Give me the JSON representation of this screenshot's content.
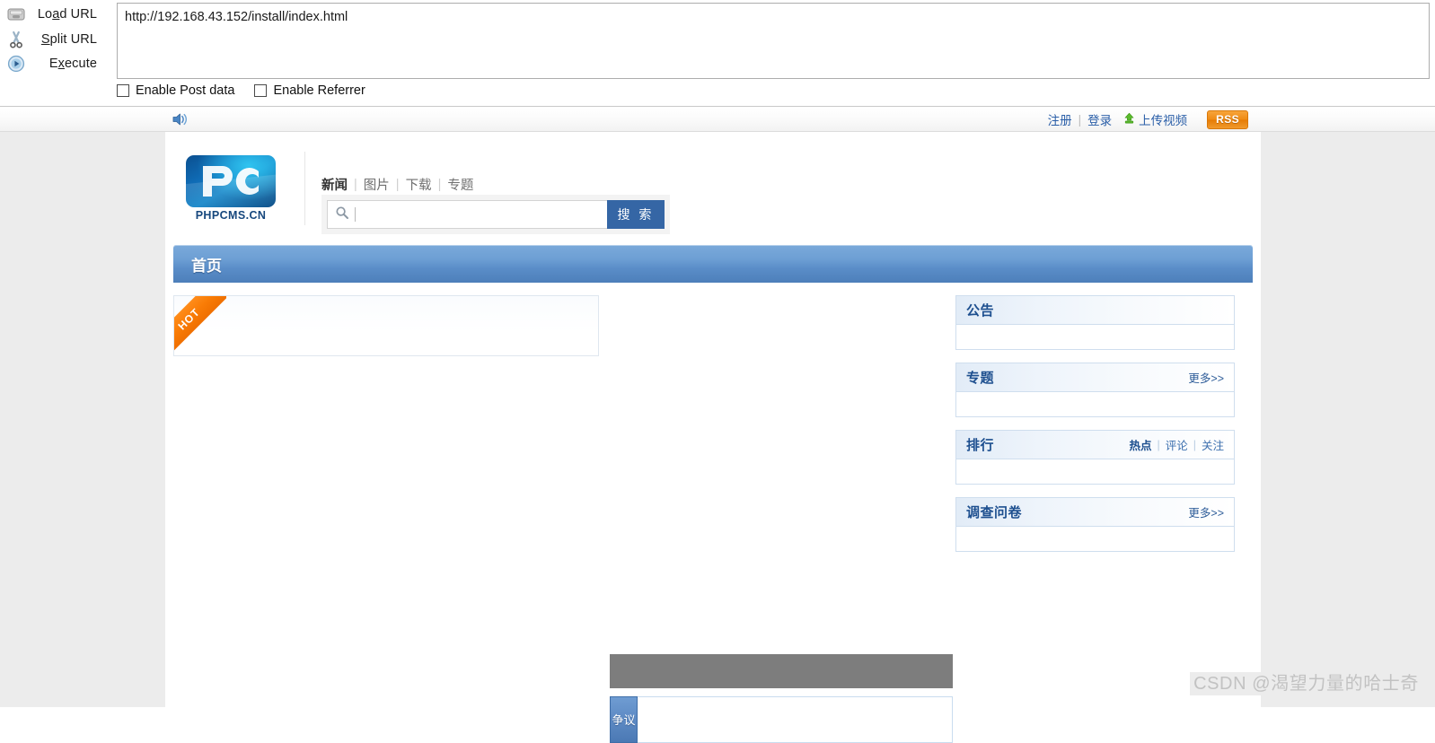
{
  "toolbar": {
    "actions": [
      {
        "icon": "load-url-icon",
        "label": "Load URL",
        "accel": "a"
      },
      {
        "icon": "scissors-icon",
        "label": "Split URL",
        "accel": "S"
      },
      {
        "icon": "execute-icon",
        "label": "Execute",
        "accel": "x"
      }
    ],
    "url_value": "http://192.168.43.152/install/index.html",
    "url_placeholder": "Enter URL",
    "checkboxes": [
      {
        "label": "Enable Post data",
        "checked": false
      },
      {
        "label": "Enable Referrer",
        "checked": false
      }
    ]
  },
  "utility_bar": {
    "speaker_icon": "speaker-icon",
    "register": "注册",
    "login": "登录",
    "upload": "上传视频",
    "upload_icon": "upload-arrow-icon",
    "rss": "RSS",
    "separator": "|"
  },
  "site_header": {
    "logo_mark": "PC",
    "logo_text": "PHPCMS.CN",
    "nav": [
      {
        "label": "新闻",
        "current": true
      },
      {
        "label": "图片",
        "current": false
      },
      {
        "label": "下载",
        "current": false
      },
      {
        "label": "专题",
        "current": false
      }
    ],
    "nav_separator": "|",
    "search": {
      "icon": "search-icon",
      "value": "",
      "placeholder": "",
      "button_label": "搜 索"
    }
  },
  "main_nav": {
    "items": [
      {
        "label": "首页",
        "current": true
      }
    ]
  },
  "content": {
    "hot_box": {
      "ribbon_label": "HOT"
    },
    "gray_block": {
      "label": ""
    },
    "vertical_tab_box": {
      "tab_label": "争议"
    }
  },
  "sidebar": {
    "panels": [
      {
        "title": "公告",
        "more": "",
        "tabs": []
      },
      {
        "title": "专题",
        "more": "更多>>",
        "tabs": []
      },
      {
        "title": "排行",
        "more": "",
        "tabs": [
          {
            "label": "热点",
            "on": true
          },
          {
            "label": "评论",
            "on": false
          },
          {
            "label": "关注",
            "on": false
          }
        ]
      },
      {
        "title": "调查问卷",
        "more": "更多>>",
        "tabs": []
      }
    ],
    "tab_separator": "|"
  },
  "watermark": {
    "text": "CSDN @渴望力量的哈士奇"
  },
  "colors": {
    "nav_blue": "#5a8dc8",
    "search_button": "#3566a5",
    "panel_title": "#1d4f8f",
    "ribbon_orange": "#f97c06",
    "rss_orange": "#ef8a13",
    "link_blue": "#2b5fa8",
    "page_bg": "#ececec",
    "gray_block": "#7d7d7d"
  }
}
